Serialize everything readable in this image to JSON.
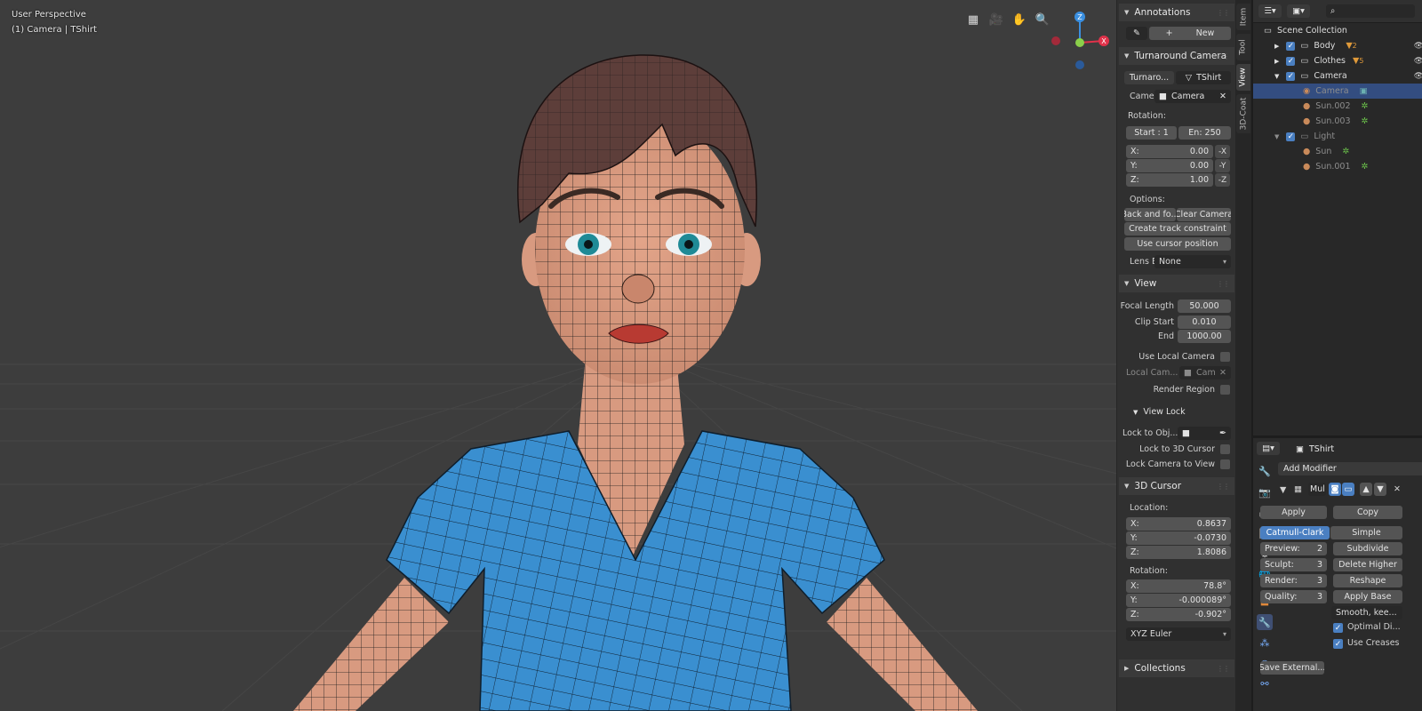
{
  "viewport": {
    "perspective_label": "User Perspective",
    "camera_label": "(1) Camera | TShirt",
    "axes": {
      "z": "Z",
      "x": "X"
    }
  },
  "npanel": {
    "tabs": [
      "Item",
      "Tool",
      "View",
      "3D-Coat"
    ],
    "annotations": {
      "title": "Annotations",
      "new_label": "New",
      "plus": "+"
    },
    "turnaround": {
      "title": "Turnaround Camera",
      "tab_a": "Turnaro...",
      "tab_b": "TShirt",
      "camera_label": "Came",
      "camera_value": "Camera",
      "rotation_label": "Rotation:",
      "start": "Start : 1",
      "end": "En:  250",
      "xyz": [
        {
          "axis": "X:",
          "value": "0.00",
          "neg": "-X"
        },
        {
          "axis": "Y:",
          "value": "0.00",
          "neg": "-Y"
        },
        {
          "axis": "Z:",
          "value": "1.00",
          "neg": "-Z"
        }
      ],
      "options_label": "Options:",
      "back_forth": "Back and fo...",
      "clear_camera": "Clear Camera",
      "create_track": "Create track constraint",
      "use_cursor": "Use cursor position",
      "lens_label": "Lens E",
      "lens_value": "None"
    },
    "view": {
      "title": "View",
      "focal_label": "Focal Length",
      "focal_value": "50.000",
      "clip_start_label": "Clip Start",
      "clip_start_value": "0.010",
      "end_label": "End",
      "end_value": "1000.00",
      "use_local_camera": "Use Local Camera",
      "local_cam_label": "Local Cam...",
      "local_cam_value": "Cam",
      "render_region": "Render Region",
      "view_lock_title": "View Lock",
      "lock_to_obj": "Lock to Obj...",
      "lock_3d_cursor": "Lock to 3D Cursor",
      "lock_camera_view": "Lock Camera to View"
    },
    "cursor": {
      "title": "3D Cursor",
      "location_label": "Location:",
      "location": [
        {
          "axis": "X:",
          "value": "0.8637"
        },
        {
          "axis": "Y:",
          "value": "-0.0730"
        },
        {
          "axis": "Z:",
          "value": "1.8086"
        }
      ],
      "rotation_label": "Rotation:",
      "rotation": [
        {
          "axis": "X:",
          "value": "78.8°"
        },
        {
          "axis": "Y:",
          "value": "-0.000089°"
        },
        {
          "axis": "Z:",
          "value": "-0.902°"
        }
      ],
      "mode": "XYZ Euler"
    },
    "collections_title": "Collections"
  },
  "outliner": {
    "root": "Scene Collection",
    "items": [
      {
        "name": "Body",
        "badge": "2"
      },
      {
        "name": "Clothes",
        "badge": "5"
      },
      {
        "name": "Camera",
        "badge": ""
      },
      {
        "name": "Camera",
        "badge": ""
      },
      {
        "name": "Sun.002",
        "badge": ""
      },
      {
        "name": "Sun.003",
        "badge": ""
      },
      {
        "name": "Light",
        "badge": ""
      },
      {
        "name": "Sun",
        "badge": ""
      },
      {
        "name": "Sun.001",
        "badge": ""
      }
    ]
  },
  "properties": {
    "object_name": "TShirt",
    "add_modifier": "Add Modifier",
    "modifier_name": "Mul",
    "apply": "Apply",
    "copy": "Copy",
    "catmull": "Catmull-Clark",
    "simple": "Simple",
    "preview_label": "Preview:",
    "preview_value": "2",
    "sculpt_label": "Sculpt:",
    "sculpt_value": "3",
    "render_label": "Render:",
    "render_value": "3",
    "quality_label": "Quality:",
    "quality_value": "3",
    "subdivide": "Subdivide",
    "delete_higher": "Delete Higher",
    "reshape": "Reshape",
    "apply_base": "Apply Base",
    "smooth": "Smooth, kee...",
    "optimal": "Optimal Di...",
    "use_creases": "Use Creases",
    "save_external": "Save External..."
  },
  "colors": {
    "accent": "#4a7fc1",
    "selected_row": "#334d80",
    "shirt": "#3a8fd0",
    "skin": "#d89a80"
  }
}
